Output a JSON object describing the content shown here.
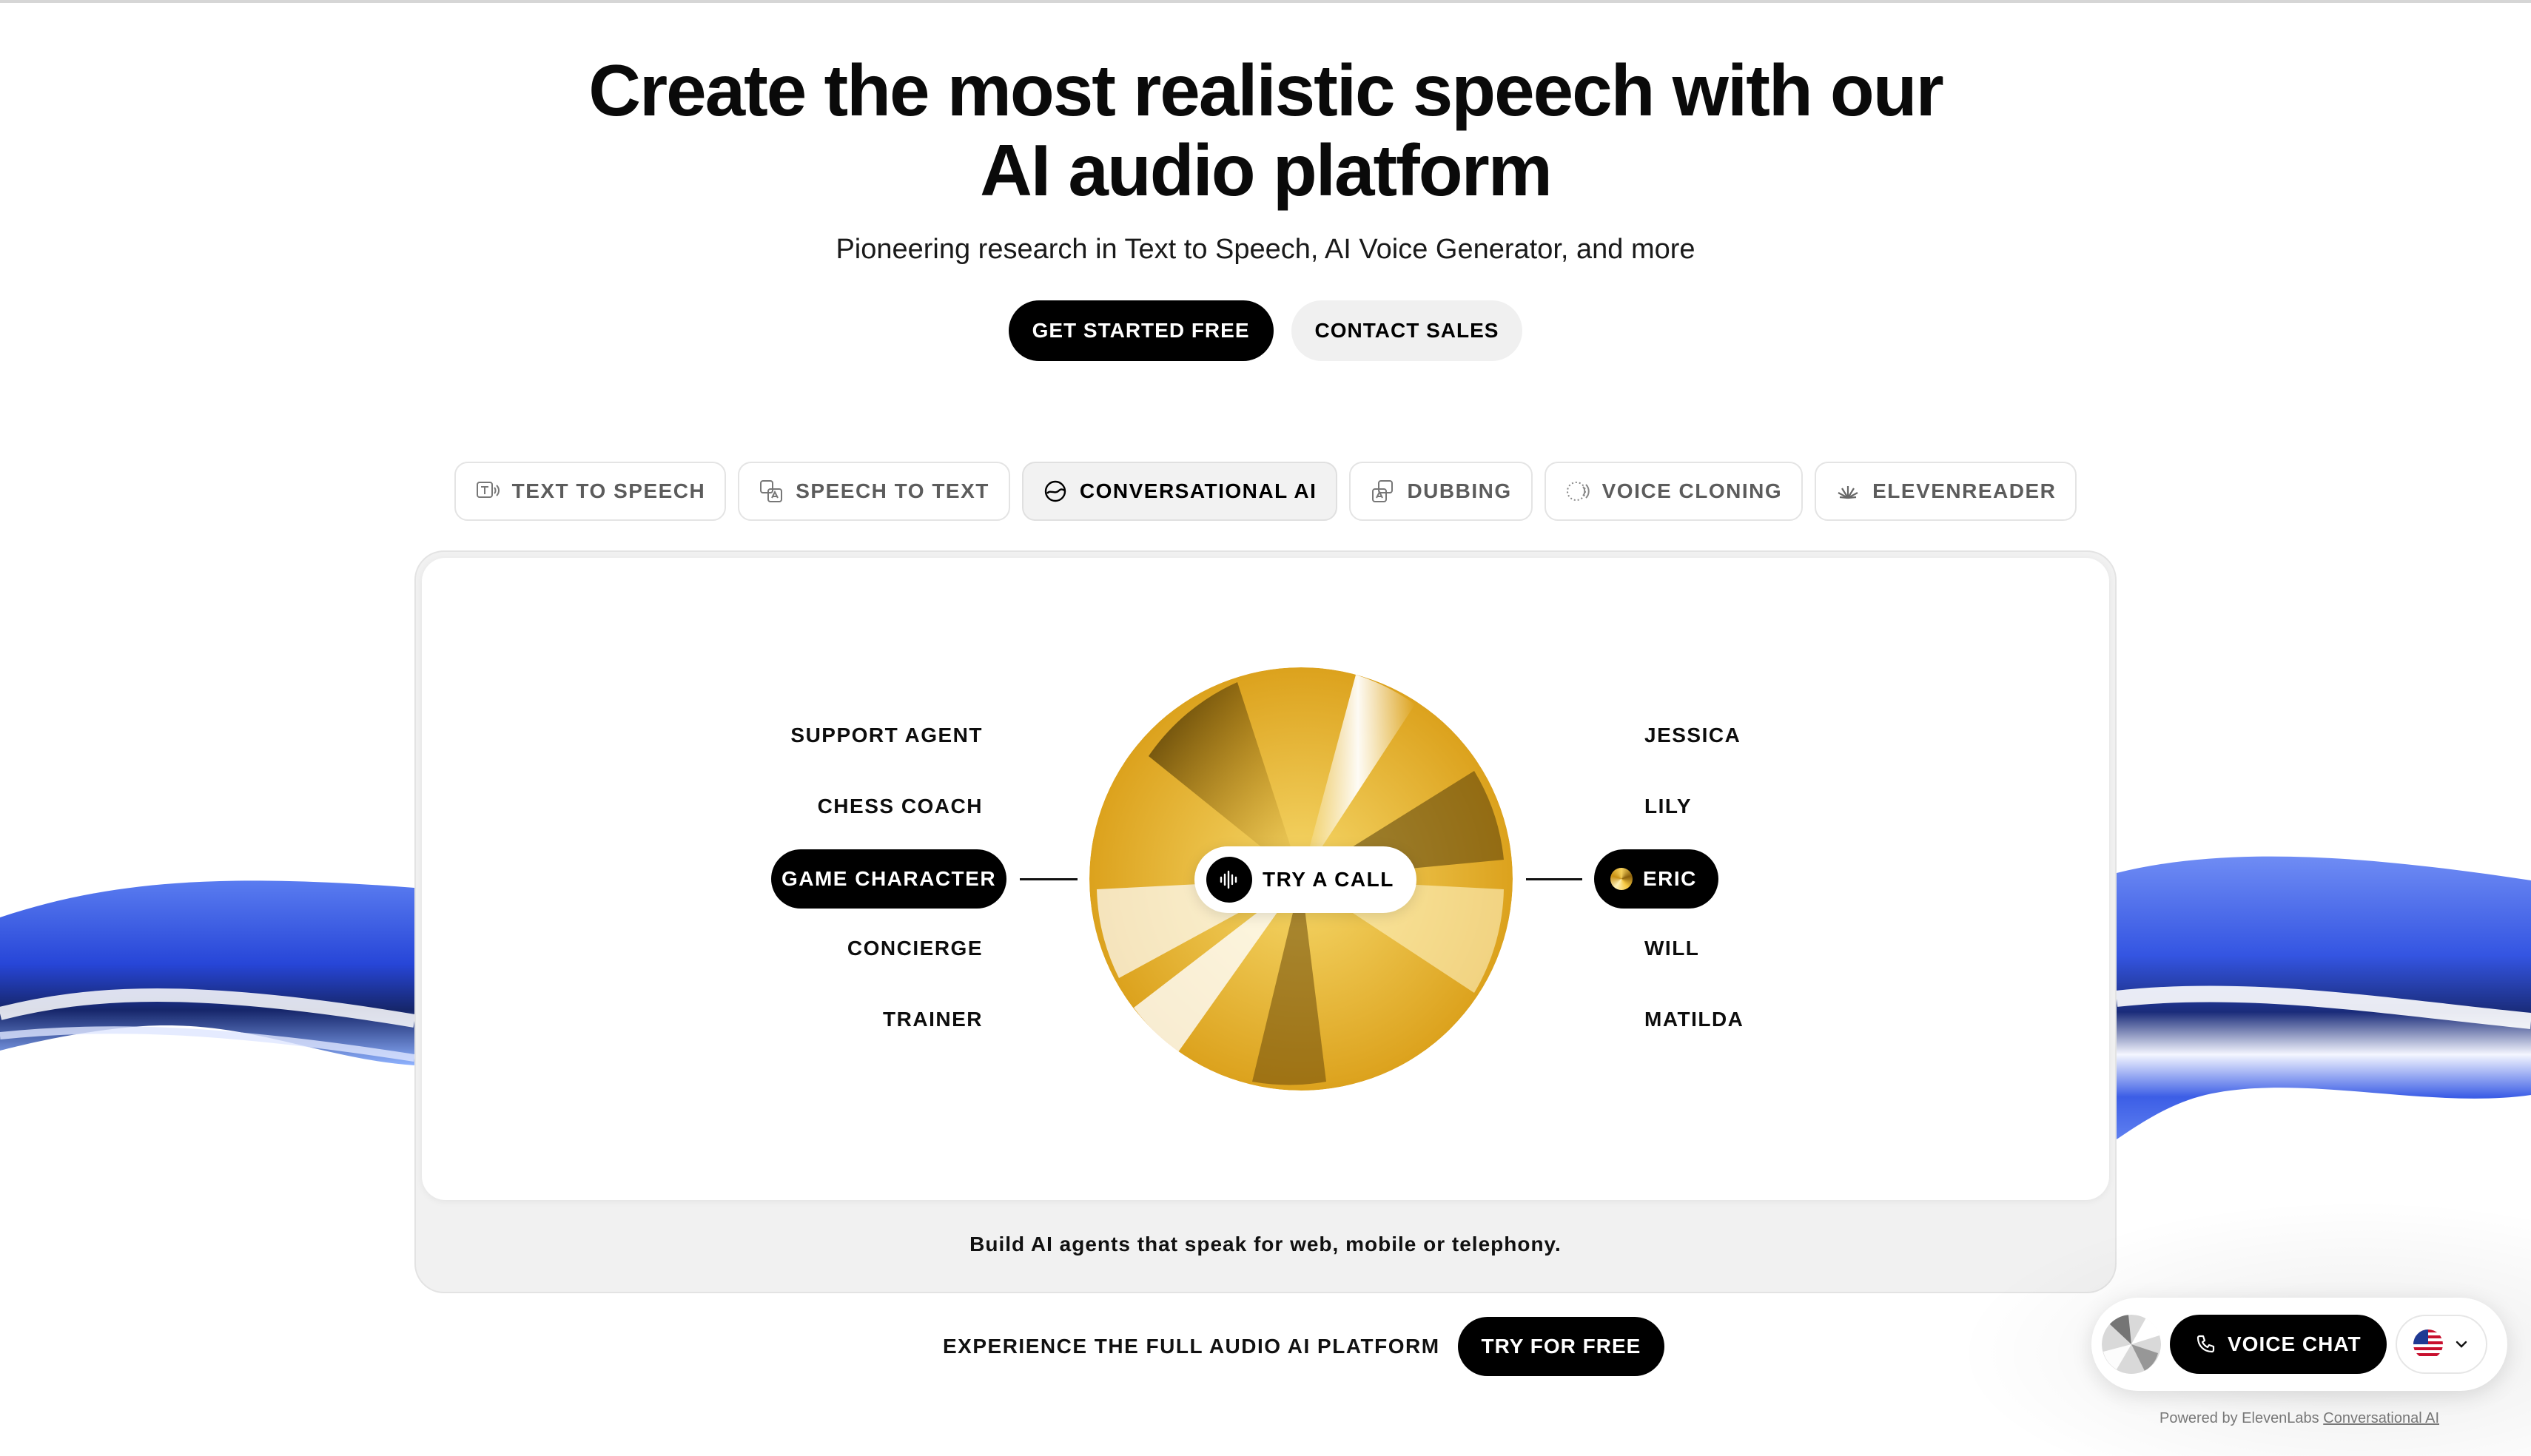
{
  "hero": {
    "title_line1": "Create the most realistic speech with our",
    "title_line2": "AI audio platform",
    "subtitle": "Pioneering research in Text to Speech, AI Voice Generator, and more",
    "primary_cta": "GET STARTED FREE",
    "secondary_cta": "CONTACT SALES"
  },
  "tabs": [
    {
      "label": "TEXT TO SPEECH",
      "icon": "text-to-speech-icon",
      "active": false
    },
    {
      "label": "SPEECH TO TEXT",
      "icon": "speech-to-text-icon",
      "active": false
    },
    {
      "label": "CONVERSATIONAL AI",
      "icon": "conversational-ai-icon",
      "active": true
    },
    {
      "label": "DUBBING",
      "icon": "dubbing-icon",
      "active": false
    },
    {
      "label": "VOICE CLONING",
      "icon": "voice-cloning-icon",
      "active": false
    },
    {
      "label": "ELEVENREADER",
      "icon": "elevenreader-icon",
      "active": false
    }
  ],
  "agents": {
    "items": [
      "SUPPORT AGENT",
      "CHESS COACH",
      "GAME CHARACTER",
      "CONCIERGE",
      "TRAINER"
    ],
    "selected": "GAME CHARACTER"
  },
  "voices": {
    "items": [
      "JESSICA",
      "LILY",
      "ERIC",
      "WILL",
      "MATILDA"
    ],
    "selected": "ERIC"
  },
  "try_call": "TRY A CALL",
  "panel_caption": "Build AI agents that speak for web, mobile or telephony.",
  "bottom": {
    "label": "EXPERIENCE THE FULL AUDIO AI PLATFORM",
    "cta": "TRY FOR FREE"
  },
  "widget": {
    "voice_chat": "VOICE CHAT",
    "language": "en-US",
    "powered_prefix": "Powered by ElevenLabs",
    "powered_link": "Conversational AI"
  },
  "colors": {
    "accent_dark": "#000000",
    "orb_gold": "#e8b92a",
    "wave_blue": "#3a5be0"
  }
}
